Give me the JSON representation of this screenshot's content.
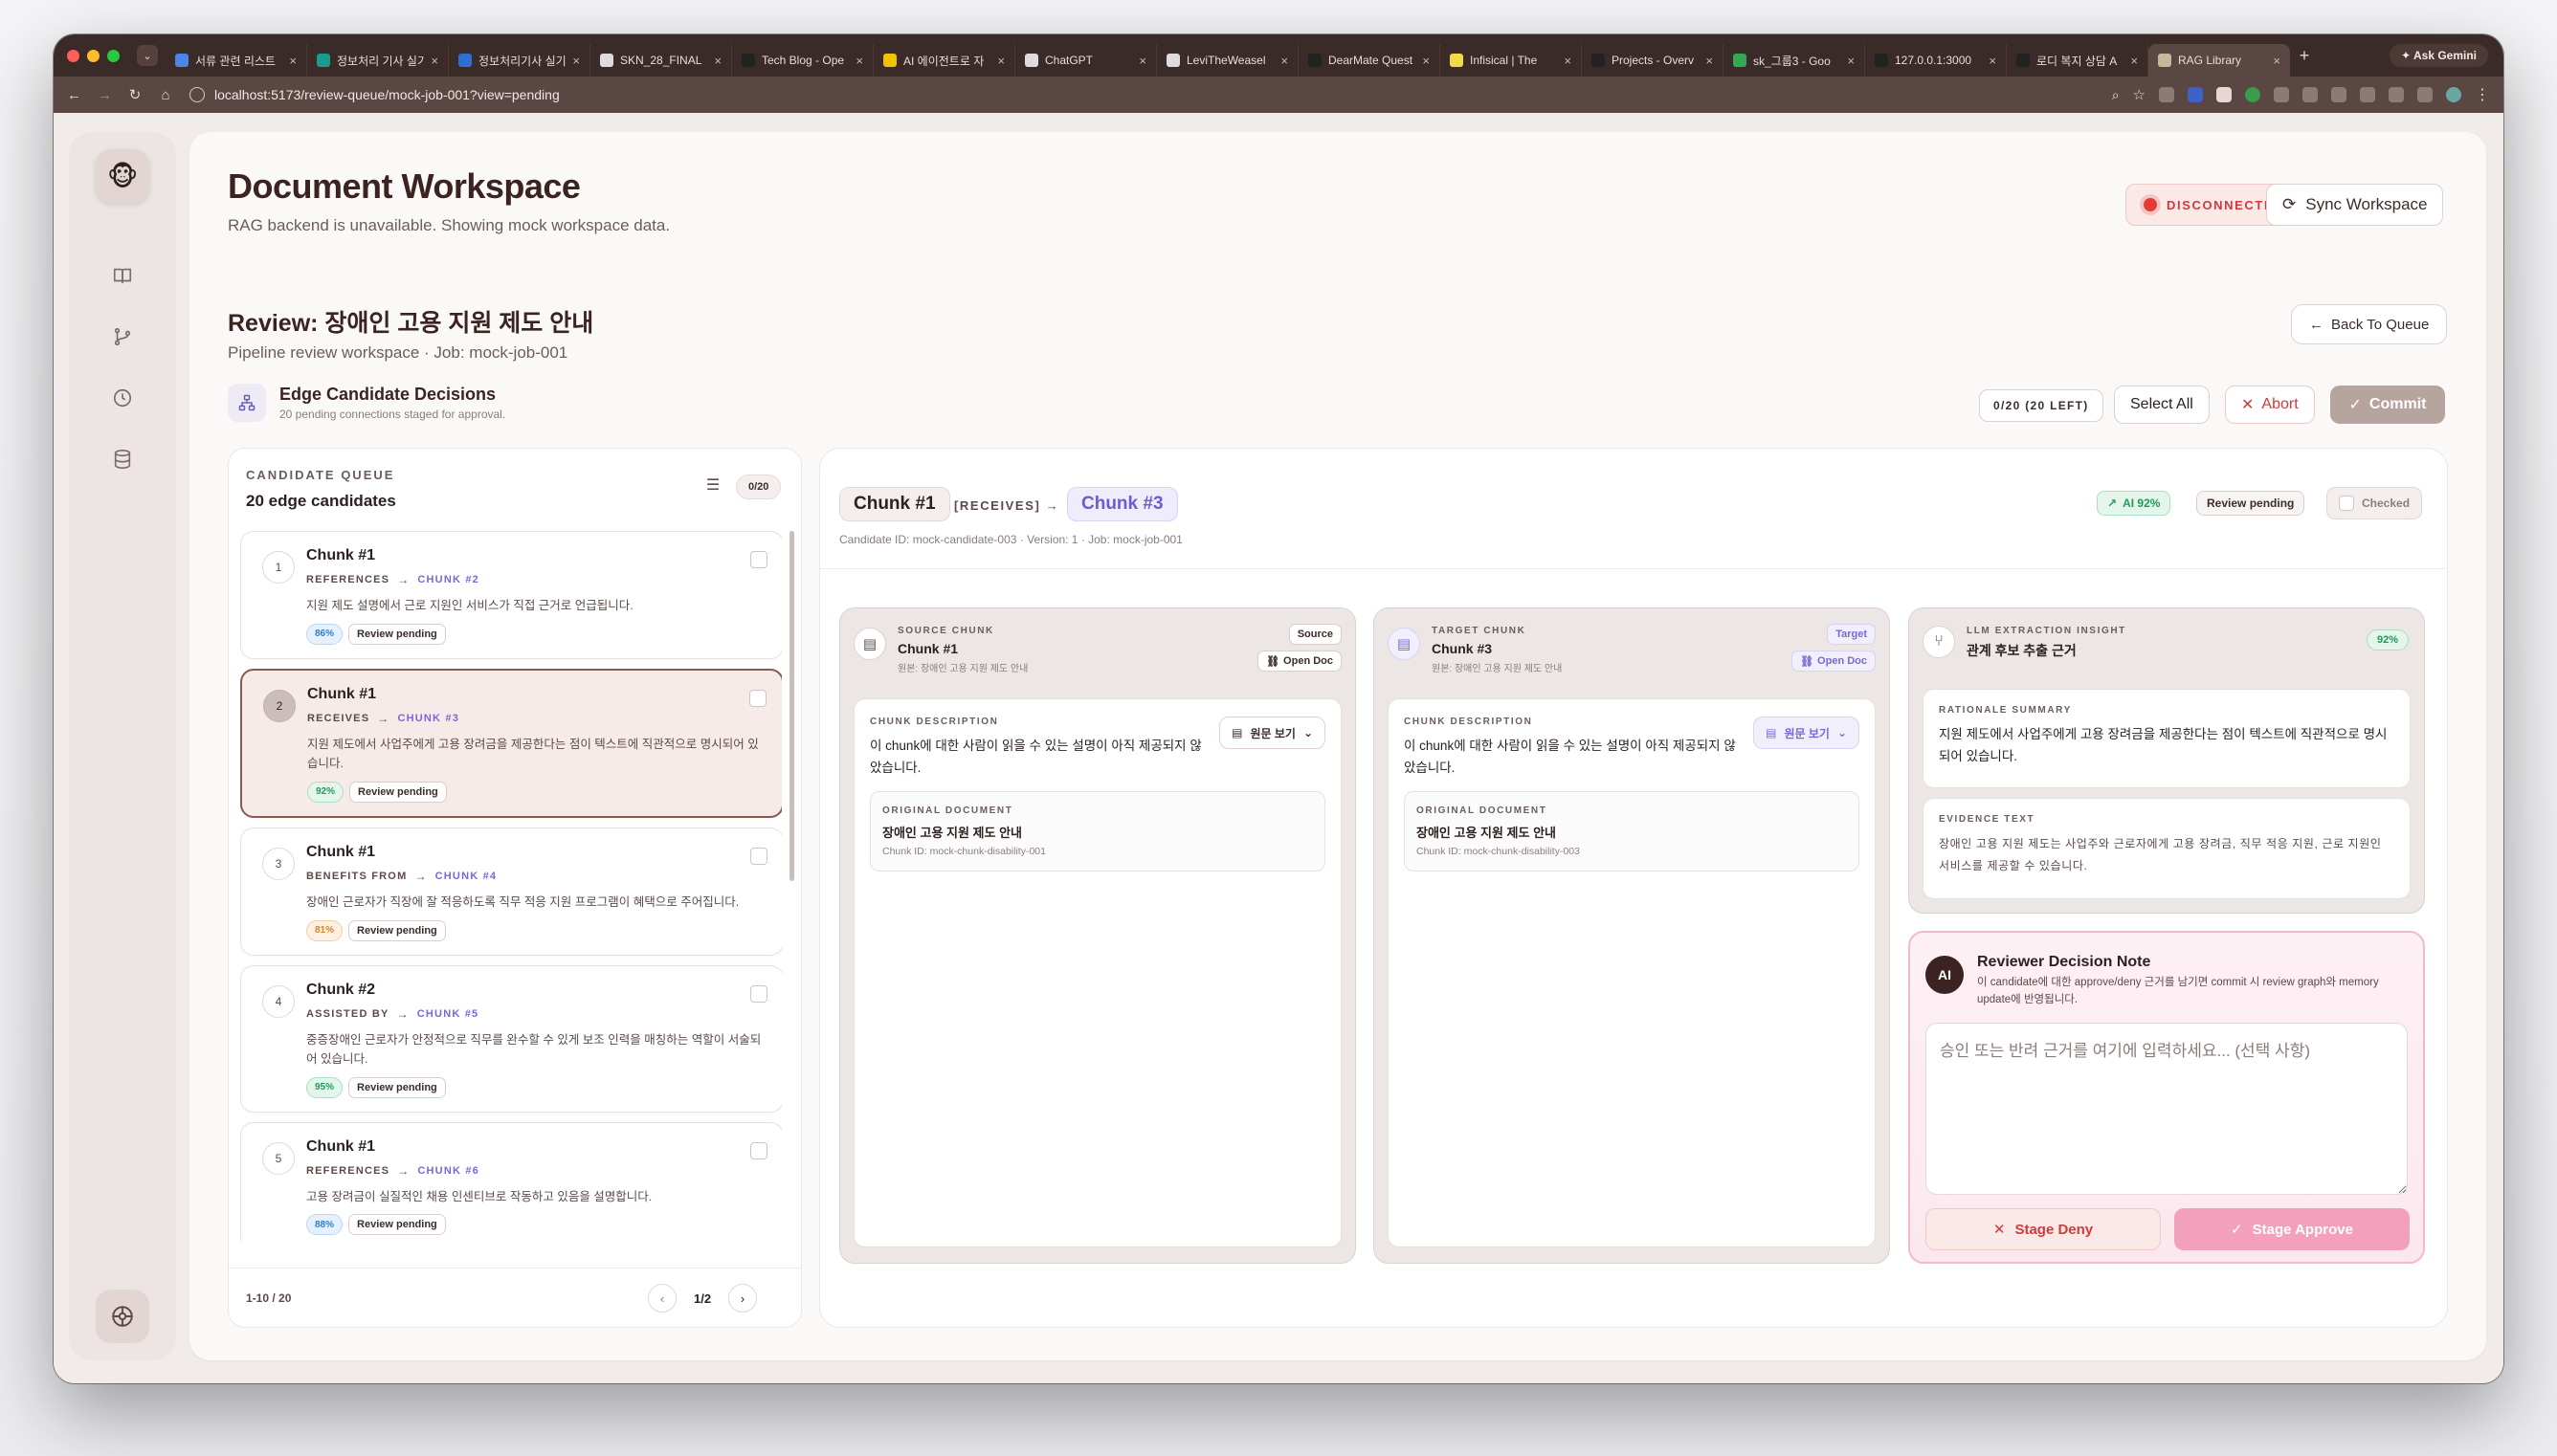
{
  "browser": {
    "tabs": [
      {
        "title": "서류 관련 리스트",
        "color": "#4a86e8"
      },
      {
        "title": "정보처리 기사 실기",
        "color": "#1a9b8c"
      },
      {
        "title": "정보처리기사 실기",
        "color": "#2f6ed3"
      },
      {
        "title": "SKN_28_FINAL",
        "color": "#dddddd"
      },
      {
        "title": "Tech Blog - Ope",
        "color": "#222222"
      },
      {
        "title": "AI 에이전트로 자",
        "color": "#f2c200"
      },
      {
        "title": "ChatGPT",
        "color": "#dddddd"
      },
      {
        "title": "LeviTheWeasel",
        "color": "#dddddd"
      },
      {
        "title": "DearMate Quest",
        "color": "#222222"
      },
      {
        "title": "Infisical | The",
        "color": "#f2d94a"
      },
      {
        "title": "Projects - Overv",
        "color": "#222222"
      },
      {
        "title": "sk_그룹3 - Goo",
        "color": "#34a853"
      },
      {
        "title": "127.0.0.1:3000",
        "color": "#222222"
      },
      {
        "title": "로디 복지 상담 A",
        "color": "#222222"
      },
      {
        "title": "RAG Library",
        "color": "#c5b99b"
      }
    ],
    "active_tab_index": 14,
    "new_tab": "+",
    "gemini_label": "✦ Ask Gemini",
    "url": "localhost:5173/review-queue/mock-job-001?view=pending"
  },
  "header": {
    "title": "Document Workspace",
    "subtitle": "RAG backend is unavailable. Showing mock workspace data.",
    "status": "DISCONNECTED",
    "sync_label": "Sync Workspace"
  },
  "review": {
    "title": "Review: 장애인 고용 지원 제도 안내",
    "subtitle": "Pipeline review workspace · Job: mock-job-001",
    "back_label": "Back To Queue"
  },
  "edge": {
    "title": "Edge Candidate Decisions",
    "subtitle": "20 pending connections staged for approval.",
    "left_count": "0/20 (20 LEFT)",
    "select_all": "Select All",
    "abort": "Abort",
    "commit": "Commit"
  },
  "queue": {
    "label": "CANDIDATE QUEUE",
    "count_title": "20 edge candidates",
    "selected_count": "0/20",
    "range": "1-10 / 20",
    "page": "1/2",
    "items": [
      {
        "num": "1",
        "title": "Chunk #1",
        "relation": "REFERENCES",
        "target": "CHUNK #2",
        "desc": "지원 제도 설명에서 근로 지원인 서비스가 직접 근거로 언급됩니다.",
        "pct": "86%",
        "pct_color": "blue",
        "status": "Review pending"
      },
      {
        "num": "2",
        "title": "Chunk #1",
        "relation": "RECEIVES",
        "target": "CHUNK #3",
        "desc": "지원 제도에서 사업주에게 고용 장려금을 제공한다는 점이 텍스트에 직관적으로 명시되어 있습니다.",
        "pct": "92%",
        "pct_color": "green",
        "status": "Review pending"
      },
      {
        "num": "3",
        "title": "Chunk #1",
        "relation": "BENEFITS FROM",
        "target": "CHUNK #4",
        "desc": "장애인 근로자가 직장에 잘 적응하도록 직무 적응 지원 프로그램이 혜택으로 주어집니다.",
        "pct": "81%",
        "pct_color": "orange",
        "status": "Review pending"
      },
      {
        "num": "4",
        "title": "Chunk #2",
        "relation": "ASSISTED BY",
        "target": "CHUNK #5",
        "desc": "중증장애인 근로자가 안정적으로 직무를 완수할 수 있게 보조 인력을 매칭하는 역할이 서술되어 있습니다.",
        "pct": "95%",
        "pct_color": "green",
        "status": "Review pending"
      },
      {
        "num": "5",
        "title": "Chunk #1",
        "relation": "REFERENCES",
        "target": "CHUNK #6",
        "desc": "고용 장려금이 실질적인 채용 인센티브로 작동하고 있음을 설명합니다.",
        "pct": "88%",
        "pct_color": "blue",
        "status": "Review pending"
      }
    ]
  },
  "detail": {
    "source_chip": "Chunk #1",
    "relation": "[RECEIVES] →",
    "target_chip": "Chunk #3",
    "candidate_meta": "Candidate ID: mock-candidate-003 · Version: 1 · Job: mock-job-001",
    "ai_badge": "AI 92%",
    "status_badge": "Review pending",
    "checked_label": "Checked",
    "source": {
      "label": "SOURCE CHUNK",
      "title": "Chunk #1",
      "origin": "원본: 장애인 고용 지원 제도 안내",
      "tag": "Source",
      "open_doc": "Open Doc",
      "desc_label": "CHUNK DESCRIPTION",
      "desc": "이 chunk에 대한 사람이 읽을 수 있는 설명이 아직 제공되지 않았습니다.",
      "orig_btn": "원문 보기",
      "orig_label": "ORIGINAL DOCUMENT",
      "orig_title": "장애인 고용 지원 제도 안내",
      "orig_id": "Chunk ID: mock-chunk-disability-001"
    },
    "target": {
      "label": "TARGET CHUNK",
      "title": "Chunk #3",
      "origin": "원본: 장애인 고용 지원 제도 안내",
      "tag": "Target",
      "open_doc": "Open Doc",
      "desc_label": "CHUNK DESCRIPTION",
      "desc": "이 chunk에 대한 사람이 읽을 수 있는 설명이 아직 제공되지 않았습니다.",
      "orig_btn": "원문 보기",
      "orig_label": "ORIGINAL DOCUMENT",
      "orig_title": "장애인 고용 지원 제도 안내",
      "orig_id": "Chunk ID: mock-chunk-disability-003"
    },
    "insight": {
      "label": "LLM EXTRACTION INSIGHT",
      "title": "관계 후보 추출 근거",
      "pct": "92%",
      "rationale_label": "RATIONALE SUMMARY",
      "rationale": "지원 제도에서 사업주에게 고용 장려금을 제공한다는 점이 텍스트에 직관적으로 명시되어 있습니다.",
      "evidence_label": "EVIDENCE TEXT",
      "evidence": "장애인 고용 지원 제도는 사업주와 근로자에게 고용 장려금, 직무 적응 지원, 근로 지원인 서비스를 제공할 수 있습니다."
    },
    "note": {
      "avatar": "AI",
      "title": "Reviewer Decision Note",
      "subtitle": "이 candidate에 대한 approve/deny 근거를 남기면 commit 시 review graph와 memory update에 반영됩니다.",
      "placeholder": "승인 또는 반려 근거를 여기에 입력하세요... (선택 사항)",
      "deny": "Stage Deny",
      "approve": "Stage Approve"
    }
  }
}
